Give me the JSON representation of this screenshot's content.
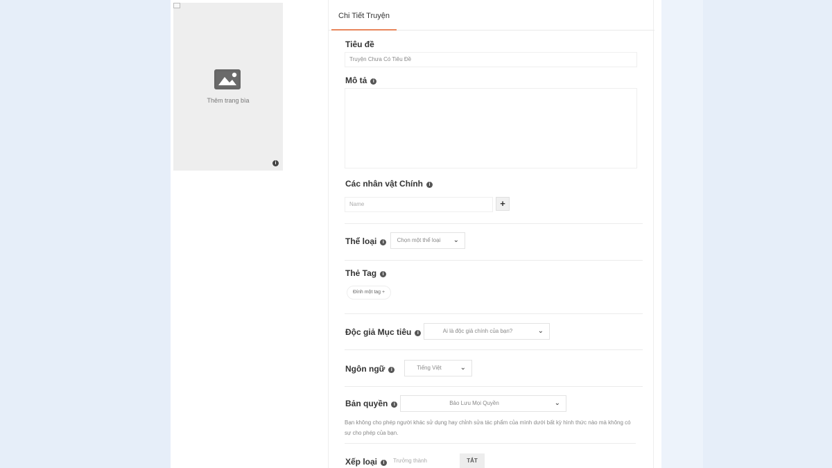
{
  "cover": {
    "label": "Thêm trang bìa"
  },
  "tabs": [
    {
      "label": "Chi Tiết Truyện"
    }
  ],
  "form": {
    "title": {
      "label": "Tiêu đề",
      "value": "Truyện Chưa Có Tiêu Đề"
    },
    "description": {
      "label": "Mô tả"
    },
    "characters": {
      "label": "Các nhân vật Chính",
      "placeholder": "Name",
      "add_label": "+"
    },
    "genre": {
      "label": "Thể loại",
      "placeholder": "Chọn một thể loại"
    },
    "tags": {
      "label": "Thẻ Tag",
      "add_label": "Đính một tag +"
    },
    "audience": {
      "label": "Độc giả Mục tiêu",
      "placeholder": "Ai là độc giả chính của bạn?"
    },
    "language": {
      "label": "Ngôn ngữ",
      "value": "Tiếng Việt"
    },
    "copyright": {
      "label": "Bản quyền",
      "value": "Bảo Lưu Mọi Quyền",
      "help": "Bạn không cho phép người khác sử dụng hay chỉnh sửa tác phẩm của mình dưới bất kỳ hình thức nào mà không có sự cho phép của bạn."
    },
    "rating": {
      "label": "Xếp loại",
      "value_label": "Trưởng thành",
      "toggle_label": "TẮT"
    }
  },
  "icons": {
    "chevron": "chevron-down-icon",
    "info": "info-icon",
    "image": "image-icon"
  },
  "colors": {
    "background": "#e6eef9",
    "tab_accent": "#e8855a",
    "cover_bg": "#eeeeee"
  }
}
